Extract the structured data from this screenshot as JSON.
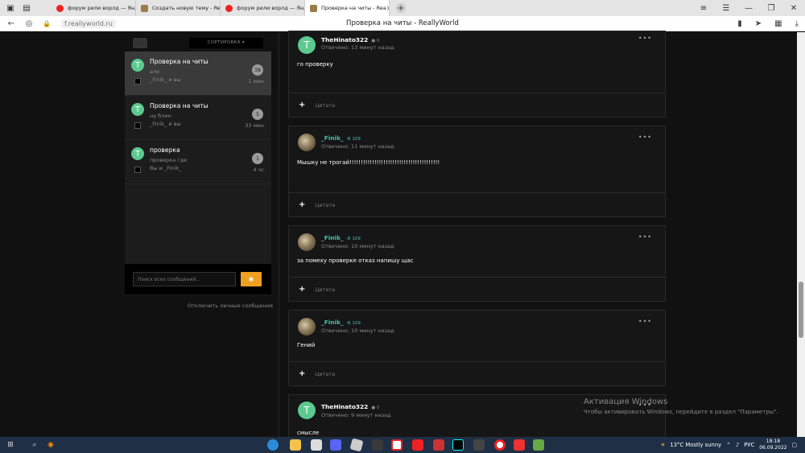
{
  "tabs": [
    {
      "title": "форум рили ворлд — Янд",
      "icon": "yandex-icon"
    },
    {
      "title": "Создать новую тему - Rea",
      "icon": "reallyworld-icon"
    },
    {
      "title": "форум рили ворлд — Янд",
      "icon": "yandex-icon"
    },
    {
      "title": "Проверка на читы - Rea",
      "icon": "reallyworld-icon"
    }
  ],
  "address": {
    "url": "f.reallyworld.ru",
    "page_title": "Проверка на читы - ReallyWorld"
  },
  "sidebar": {
    "sort_label": "СОРТИРОВКА ▾",
    "conversations": [
      {
        "title": "Проверка на читы",
        "preview": "але",
        "participants": "_Finik_ и вы",
        "count": "38",
        "time": "1 мин"
      },
      {
        "title": "Проверка на читы",
        "preview": "ну блин",
        "participants": "_Finik_ и вы",
        "count": "5",
        "time": "33 мин"
      },
      {
        "title": "проверка",
        "preview": "проверка где",
        "participants": "Вы и _Finik_",
        "count": "1",
        "time": "4 чс"
      }
    ],
    "search_placeholder": "Поиск всех сообщений...",
    "disable_link": "Отключить личные сообщения"
  },
  "posts": [
    {
      "author": "TheHinato322",
      "rep": "0",
      "time": "Отвечено: 13 минут назад",
      "text": "го проверку",
      "quote": "Цитата"
    },
    {
      "author": "_Finik_",
      "rep": "109",
      "time": "Отвечено: 11 минут назад",
      "text": "Мышку не трогай!!!!!!!!!!!!!!!!!!!!!!!!!!!!!!!!!!!!!!!!",
      "quote": "Цитата"
    },
    {
      "author": "_Finik_",
      "rep": "109",
      "time": "Отвечено: 10 минут назад",
      "text": "за помеху проверке отказ напишу щас",
      "quote": "Цитата"
    },
    {
      "author": "_Finik_",
      "rep": "109",
      "time": "Отвечено: 10 минут назад",
      "text": "Гений",
      "quote": "Цитата"
    },
    {
      "author": "TheHinato322",
      "rep": "0",
      "time": "Отвечено: 9 минут назад",
      "text": "смысле",
      "quote": ""
    }
  ],
  "watermark": {
    "line1": "Активация Windows",
    "line2": "Чтобы активировать Windows, перейдите в раздел \"Параметры\"."
  },
  "taskbar": {
    "weather": "13°C Mostly sunny",
    "lang": "РУС",
    "time": "18:18",
    "date": "06.09.2022"
  },
  "colors": {
    "accent": "#f0a020",
    "avatar_green": "#5cc98f",
    "name_green": "#3fc6a8"
  }
}
